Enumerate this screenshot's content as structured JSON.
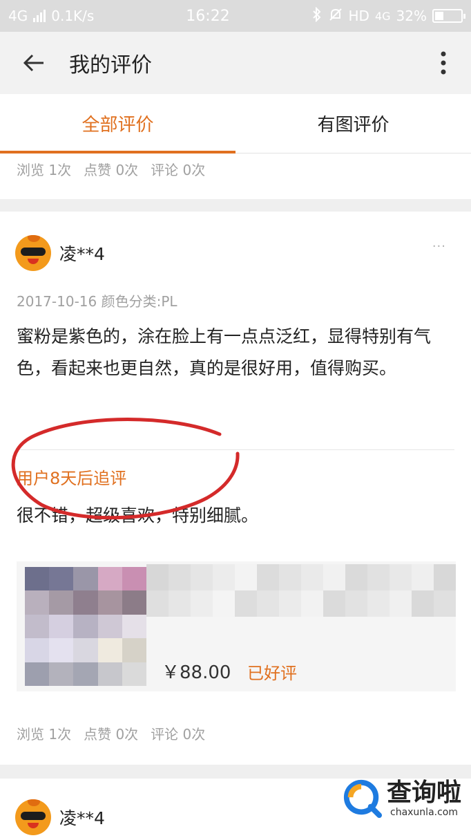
{
  "status_bar": {
    "network_left": "4G",
    "speed": "0.1K/s",
    "time": "16:22",
    "network_right": "HD",
    "network_type": "4G",
    "battery_level": 0.32,
    "battery": "32%"
  },
  "app_bar": {
    "title": "我的评价",
    "back_icon": "arrow-left-icon",
    "more_icon": "more-vertical-icon"
  },
  "tabs": [
    {
      "label": "全部评价",
      "active": true
    },
    {
      "label": "有图评价",
      "active": false
    }
  ],
  "reviews": [
    {
      "stats": [
        "浏览 1次",
        "点赞 0次",
        "评论 0次"
      ]
    },
    {
      "username": "凌**4",
      "more": "···",
      "meta": "2017-10-16  颜色分类:PL",
      "content": "蜜粉是紫色的，涂在脸上有一点点泛红，显得特别有气色，看起来也更自然，真的是很好用，值得购买。",
      "followup_title": "用户8天后追评",
      "followup_text": "很不错，超级喜欢，特别细腻。",
      "product": {
        "price": "￥88.00",
        "status": "已好评"
      },
      "stats": [
        "浏览 1次",
        "点赞 0次",
        "评论 0次"
      ]
    },
    {
      "username": "凌**4"
    }
  ],
  "watermark": {
    "cn": "查询啦",
    "en": "chaxunla.com"
  },
  "colors": {
    "accent": "#e0701f",
    "annotation": "#d42a2a"
  }
}
